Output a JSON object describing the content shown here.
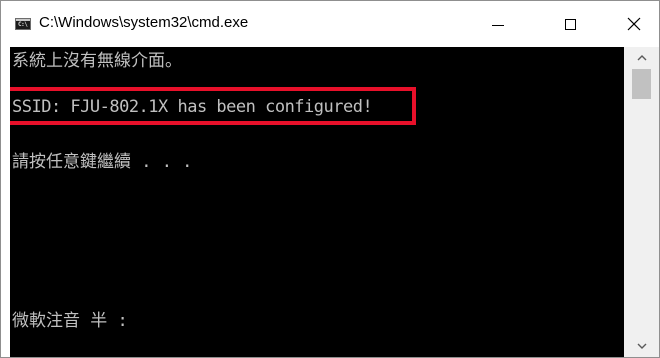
{
  "window": {
    "title": "C:\\Windows\\system32\\cmd.exe",
    "icon": "cmd-icon",
    "icon_text": "C:\\"
  },
  "title_buttons": {
    "minimize": "minimize-icon",
    "maximize": "maximize-icon",
    "close": "close-icon"
  },
  "console": {
    "background": "#000000",
    "text_color": "#c0c0c0",
    "lines": [
      "系統上沒有無線介面。",
      "SSID: FJU-802.1X has been configured!",
      "請按任意鍵繼續 . . .",
      "微軟注音 半 :"
    ]
  },
  "highlight": {
    "color": "#e8102a"
  },
  "scrollbar": {
    "up": "chevron-up-icon",
    "down": "chevron-down-icon"
  }
}
